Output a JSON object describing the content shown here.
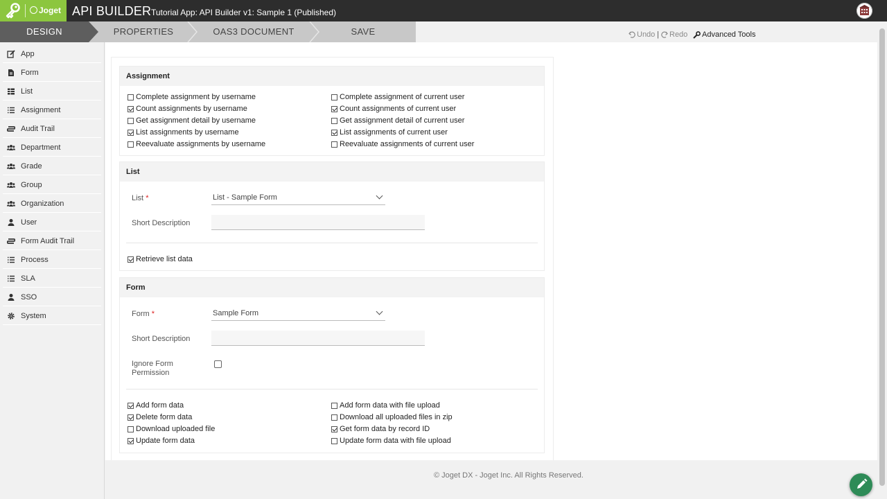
{
  "header": {
    "logo_text": "Joget",
    "title": "API BUILDER",
    "subtitle": "Tutorial App: API Builder v1: Sample 1 (Published)"
  },
  "tabs": [
    {
      "label": "DESIGN",
      "active": true
    },
    {
      "label": "PROPERTIES",
      "active": false
    },
    {
      "label": "OAS3 DOCUMENT",
      "active": false
    },
    {
      "label": "SAVE",
      "active": false
    }
  ],
  "toolbar": {
    "undo_label": "Undo",
    "separator": "|",
    "redo_label": "Redo",
    "advanced_label": "Advanced Tools"
  },
  "sidebar": {
    "items": [
      {
        "label": "App",
        "icon": "edit-icon"
      },
      {
        "label": "Form",
        "icon": "file-icon"
      },
      {
        "label": "List",
        "icon": "table-icon"
      },
      {
        "label": "Assignment",
        "icon": "list-icon"
      },
      {
        "label": "Audit Trail",
        "icon": "audit-icon"
      },
      {
        "label": "Department",
        "icon": "users-icon"
      },
      {
        "label": "Grade",
        "icon": "users-icon"
      },
      {
        "label": "Group",
        "icon": "users-icon"
      },
      {
        "label": "Organization",
        "icon": "users-icon"
      },
      {
        "label": "User",
        "icon": "user-icon"
      },
      {
        "label": "Form Audit Trail",
        "icon": "audit-icon"
      },
      {
        "label": "Process",
        "icon": "list-icon"
      },
      {
        "label": "SLA",
        "icon": "list-icon"
      },
      {
        "label": "SSO",
        "icon": "user-icon"
      },
      {
        "label": "System",
        "icon": "gear-icon"
      }
    ]
  },
  "assignment": {
    "title": "Assignment",
    "options_left": [
      {
        "label": "Complete assignment by username",
        "checked": false
      },
      {
        "label": "Count assignments by username",
        "checked": true
      },
      {
        "label": "Get assignment detail by username",
        "checked": false
      },
      {
        "label": "List assignments by username",
        "checked": true
      },
      {
        "label": "Reevaluate assignments by username",
        "checked": false
      }
    ],
    "options_right": [
      {
        "label": "Complete assignment of current user",
        "checked": false
      },
      {
        "label": "Count assignments of current user",
        "checked": true
      },
      {
        "label": "Get assignment detail of current user",
        "checked": false
      },
      {
        "label": "List assignments of current user",
        "checked": true
      },
      {
        "label": "Reevaluate assignments of current user",
        "checked": false
      }
    ]
  },
  "list_section": {
    "title": "List",
    "list_label": "List",
    "required_mark": "*",
    "list_value": "List - Sample Form",
    "short_desc_label": "Short Description",
    "short_desc_value": "",
    "retrieve_label": "Retrieve list data",
    "retrieve_checked": true
  },
  "form_section": {
    "title": "Form",
    "form_label": "Form",
    "required_mark": "*",
    "form_value": "Sample Form",
    "short_desc_label": "Short Description",
    "short_desc_value": "",
    "ignore_label_1": "Ignore Form",
    "ignore_label_2": "Permission",
    "ignore_checked": false,
    "options_left": [
      {
        "label": "Add form data",
        "checked": true
      },
      {
        "label": "Delete form data",
        "checked": true
      },
      {
        "label": "Download uploaded file",
        "checked": false
      },
      {
        "label": "Update form data",
        "checked": true
      }
    ],
    "options_right": [
      {
        "label": "Add form data with file upload",
        "checked": false
      },
      {
        "label": "Download all uploaded files in zip",
        "checked": false
      },
      {
        "label": "Get form data by record ID",
        "checked": true
      },
      {
        "label": "Update form data with file upload",
        "checked": false
      }
    ]
  },
  "footer": {
    "text": "© Joget DX - Joget Inc. All Rights Reserved."
  },
  "colors": {
    "brand_green": "#8cc63f",
    "header_dark": "#2d2d2d",
    "tab_active": "#5e5e5e",
    "fab_green": "#2e8b57"
  }
}
